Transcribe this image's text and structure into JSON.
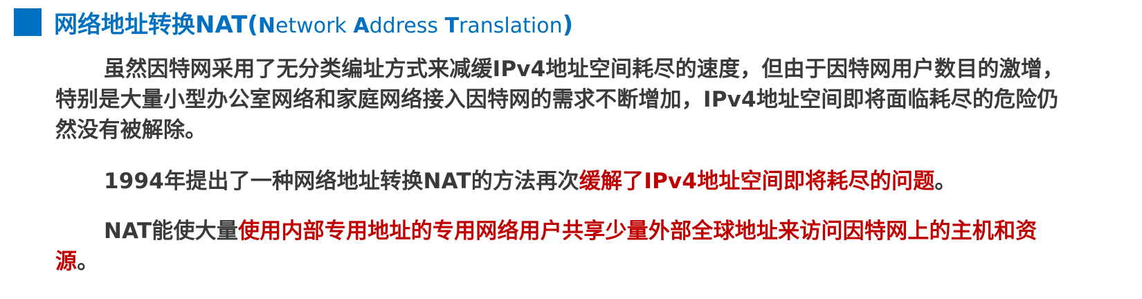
{
  "title": {
    "zh": "网络地址转换NAT",
    "open_paren": "(",
    "en_N": "N",
    "en_etwork": "etwork ",
    "en_A": "A",
    "en_ddress": "ddress ",
    "en_T": "T",
    "en_ranslation": "ranslation",
    "close_paren": ")"
  },
  "paragraphs": {
    "p1": "虽然因特网采用了无分类编址方式来减缓IPv4地址空间耗尽的速度，但由于因特网用户数目的激增，特别是大量小型办公室网络和家庭网络接入因特网的需求不断增加，IPv4地址空间即将面临耗尽的危险仍然没有被解除。",
    "p2_plain": "1994年提出了一种网络地址转换NAT的方法再次",
    "p2_red": "缓解了IPv4地址空间即将耗尽的问题",
    "p2_end": "。",
    "p3_plain": "NAT能使大量",
    "p3_red": "使用内部专用地址的专用网络用户共享少量外部全球地址来访问因特网上的主机和资源",
    "p3_end": "。"
  },
  "colors": {
    "accent_blue": "#0070c0",
    "highlight_red": "#c00000",
    "body_text": "#3a3a3a"
  }
}
